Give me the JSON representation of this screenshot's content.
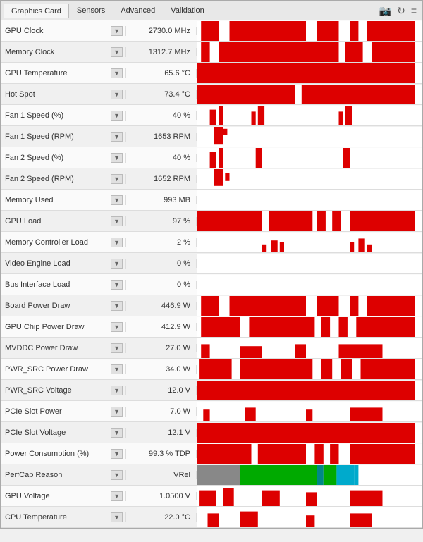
{
  "tabs": [
    {
      "label": "Graphics Card",
      "active": true
    },
    {
      "label": "Sensors",
      "active": false
    },
    {
      "label": "Advanced",
      "active": false
    },
    {
      "label": "Validation",
      "active": false
    }
  ],
  "icons": {
    "camera": "📷",
    "refresh": "↻",
    "menu": "≡"
  },
  "sensors": [
    {
      "name": "GPU Clock",
      "value": "2730.0 MHz",
      "graph": "mixed-red"
    },
    {
      "name": "Memory Clock",
      "value": "1312.7 MHz",
      "graph": "mostly-red"
    },
    {
      "name": "GPU Temperature",
      "value": "65.6 °C",
      "graph": "solid-red"
    },
    {
      "name": "Hot Spot",
      "value": "73.4 °C",
      "graph": "solid-red-break"
    },
    {
      "name": "Fan 1 Speed (%)",
      "value": "40 %",
      "graph": "spike-low"
    },
    {
      "name": "Fan 1 Speed (RPM)",
      "value": "1653 RPM",
      "graph": "spike-mid"
    },
    {
      "name": "Fan 2 Speed (%)",
      "value": "40 %",
      "graph": "spike-low2"
    },
    {
      "name": "Fan 2 Speed (RPM)",
      "value": "1652 RPM",
      "graph": "spike-mid2"
    },
    {
      "name": "Memory Used",
      "value": "993 MB",
      "graph": "empty"
    },
    {
      "name": "GPU Load",
      "value": "97 %",
      "graph": "high-red"
    },
    {
      "name": "Memory Controller Load",
      "value": "2 %",
      "graph": "tiny-spikes"
    },
    {
      "name": "Video Engine Load",
      "value": "0 %",
      "graph": "empty"
    },
    {
      "name": "Bus Interface Load",
      "value": "0 %",
      "graph": "empty"
    },
    {
      "name": "Board Power Draw",
      "value": "446.9 W",
      "graph": "mixed-red"
    },
    {
      "name": "GPU Chip Power Draw",
      "value": "412.9 W",
      "graph": "mixed-red2"
    },
    {
      "name": "MVDDC Power Draw",
      "value": "27.0 W",
      "graph": "low-red"
    },
    {
      "name": "PWR_SRC Power Draw",
      "value": "34.0 W",
      "graph": "mixed-red3"
    },
    {
      "name": "PWR_SRC Voltage",
      "value": "12.0 V",
      "graph": "solid-red"
    },
    {
      "name": "PCIe Slot Power",
      "value": "7.0 W",
      "graph": "low-red2"
    },
    {
      "name": "PCIe Slot Voltage",
      "value": "12.1 V",
      "graph": "solid-red"
    },
    {
      "name": "Power Consumption (%)",
      "value": "99.3 % TDP",
      "graph": "high-red2"
    },
    {
      "name": "PerfCap Reason",
      "value": "VRel",
      "graph": "perf-cap"
    },
    {
      "name": "GPU Voltage",
      "value": "1.0500 V",
      "graph": "low-red3"
    },
    {
      "name": "CPU Temperature",
      "value": "22.0 °C",
      "graph": "tiny-red"
    }
  ]
}
